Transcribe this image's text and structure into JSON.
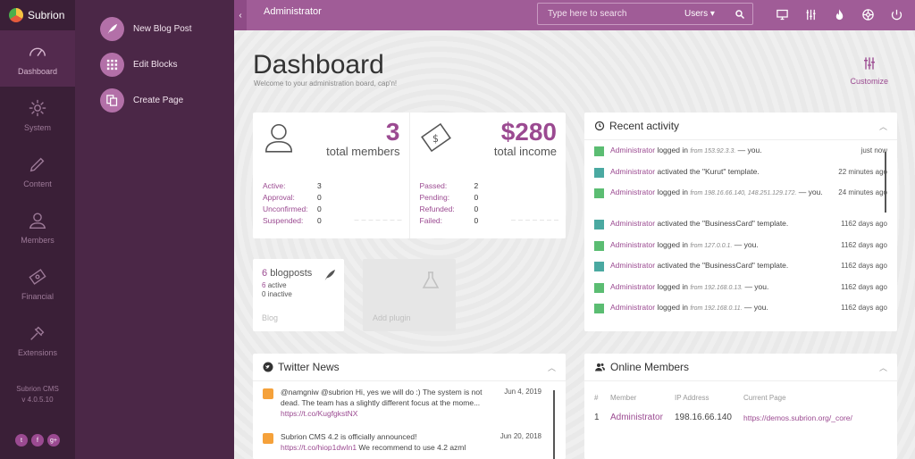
{
  "brand": {
    "name": "Subrion",
    "version_line1": "Subrion CMS",
    "version_line2": "v 4.0.5.10"
  },
  "rail": {
    "items": [
      {
        "label": "Dashboard",
        "icon": "gauge-icon"
      },
      {
        "label": "System",
        "icon": "gear-icon"
      },
      {
        "label": "Content",
        "icon": "pencil-icon"
      },
      {
        "label": "Members",
        "icon": "user-icon"
      },
      {
        "label": "Financial",
        "icon": "money-icon"
      },
      {
        "label": "Extensions",
        "icon": "puzzle-icon"
      }
    ],
    "social": [
      "t",
      "f",
      "g+"
    ]
  },
  "quick": {
    "items": [
      {
        "label": "New Blog Post",
        "icon": "quill-icon"
      },
      {
        "label": "Edit Blocks",
        "icon": "grid-icon"
      },
      {
        "label": "Create Page",
        "icon": "pages-icon"
      }
    ]
  },
  "topbar": {
    "title": "Administrator",
    "search_placeholder": "Type here to search",
    "search_scope": "Users",
    "icons": [
      "monitor-icon",
      "sliders-icon",
      "fire-icon",
      "support-icon",
      "power-icon"
    ]
  },
  "page": {
    "title": "Dashboard",
    "subtitle": "Welcome to your administration board, cap'n!",
    "customize": "Customize"
  },
  "stats": {
    "members": {
      "count": "3",
      "label": "total members",
      "rows": [
        {
          "k": "Active:",
          "v": "3"
        },
        {
          "k": "Approval:",
          "v": "0"
        },
        {
          "k": "Unconfirmed:",
          "v": "0"
        },
        {
          "k": "Suspended:",
          "v": "0"
        }
      ]
    },
    "income": {
      "count": "$280",
      "label": "total income",
      "rows": [
        {
          "k": "Passed:",
          "v": "2"
        },
        {
          "k": "Pending:",
          "v": "0"
        },
        {
          "k": "Refunded:",
          "v": "0"
        },
        {
          "k": "Failed:",
          "v": "0"
        }
      ]
    }
  },
  "blog": {
    "count": "6",
    "label": "blogposts",
    "active_n": "6",
    "active": "active",
    "inactive_n": "0",
    "inactive": "inactive",
    "footer": "Blog"
  },
  "plugin": {
    "label": "Add plugin"
  },
  "recent": {
    "title": "Recent activity",
    "items": [
      {
        "who": "Administrator",
        "text": " logged in ",
        "from": "from 153.92.3.3.",
        "tail": " — you.",
        "time": "just now",
        "type": "login"
      },
      {
        "who": "Administrator",
        "text": " activated the \"Kurut\" template.",
        "from": "",
        "tail": "",
        "time": "22 minutes ago",
        "type": "view"
      },
      {
        "who": "Administrator",
        "text": " logged in ",
        "from": "from 198.16.66.140, 148.251.129.172.",
        "tail": " — you.",
        "time": "24 minutes ago",
        "type": "login"
      },
      {
        "who": "Administrator",
        "text": " activated the \"BusinessCard\" template.",
        "from": "",
        "tail": "",
        "time": "1162 days ago",
        "type": "view"
      },
      {
        "who": "Administrator",
        "text": " logged in ",
        "from": "from 127.0.0.1.",
        "tail": " — you.",
        "time": "1162 days ago",
        "type": "login"
      },
      {
        "who": "Administrator",
        "text": " activated the \"BusinessCard\" template.",
        "from": "",
        "tail": "",
        "time": "1162 days ago",
        "type": "view"
      },
      {
        "who": "Administrator",
        "text": " logged in ",
        "from": "from 192.168.0.13.",
        "tail": " — you.",
        "time": "1162 days ago",
        "type": "login"
      },
      {
        "who": "Administrator",
        "text": " logged in ",
        "from": "from 192.168.0.11.",
        "tail": " — you.",
        "time": "1162 days ago",
        "type": "login"
      }
    ]
  },
  "twitter": {
    "title": "Twitter News",
    "items": [
      {
        "text": "@namgniw @subrion Hi, yes we will do :) The system is not dead. The team has a slightly different focus at the mome... ",
        "link": "https://t.co/KugfgkstNX",
        "date": "Jun 4, 2019"
      },
      {
        "text": "Subrion CMS 4.2 is officially announced! ",
        "link": "https://t.co/hiop1dwIn1",
        "tail": " We recommend to use 4.2 azml",
        "date": "Jun 20, 2018"
      }
    ]
  },
  "online": {
    "title": "Online Members",
    "headers": [
      "#",
      "Member",
      "IP Address",
      "Current Page"
    ],
    "rows": [
      {
        "n": "1",
        "member": "Administrator",
        "ip": "198.16.66.140",
        "page": "https://demos.subrion.org/_core/"
      }
    ]
  },
  "colors": {
    "accent": "#9b4a91",
    "topbar": "#a05c97",
    "rail": "#3a1f37",
    "quick": "#4b2747",
    "ok": "#5bbd72",
    "view": "#4aa9a1"
  }
}
